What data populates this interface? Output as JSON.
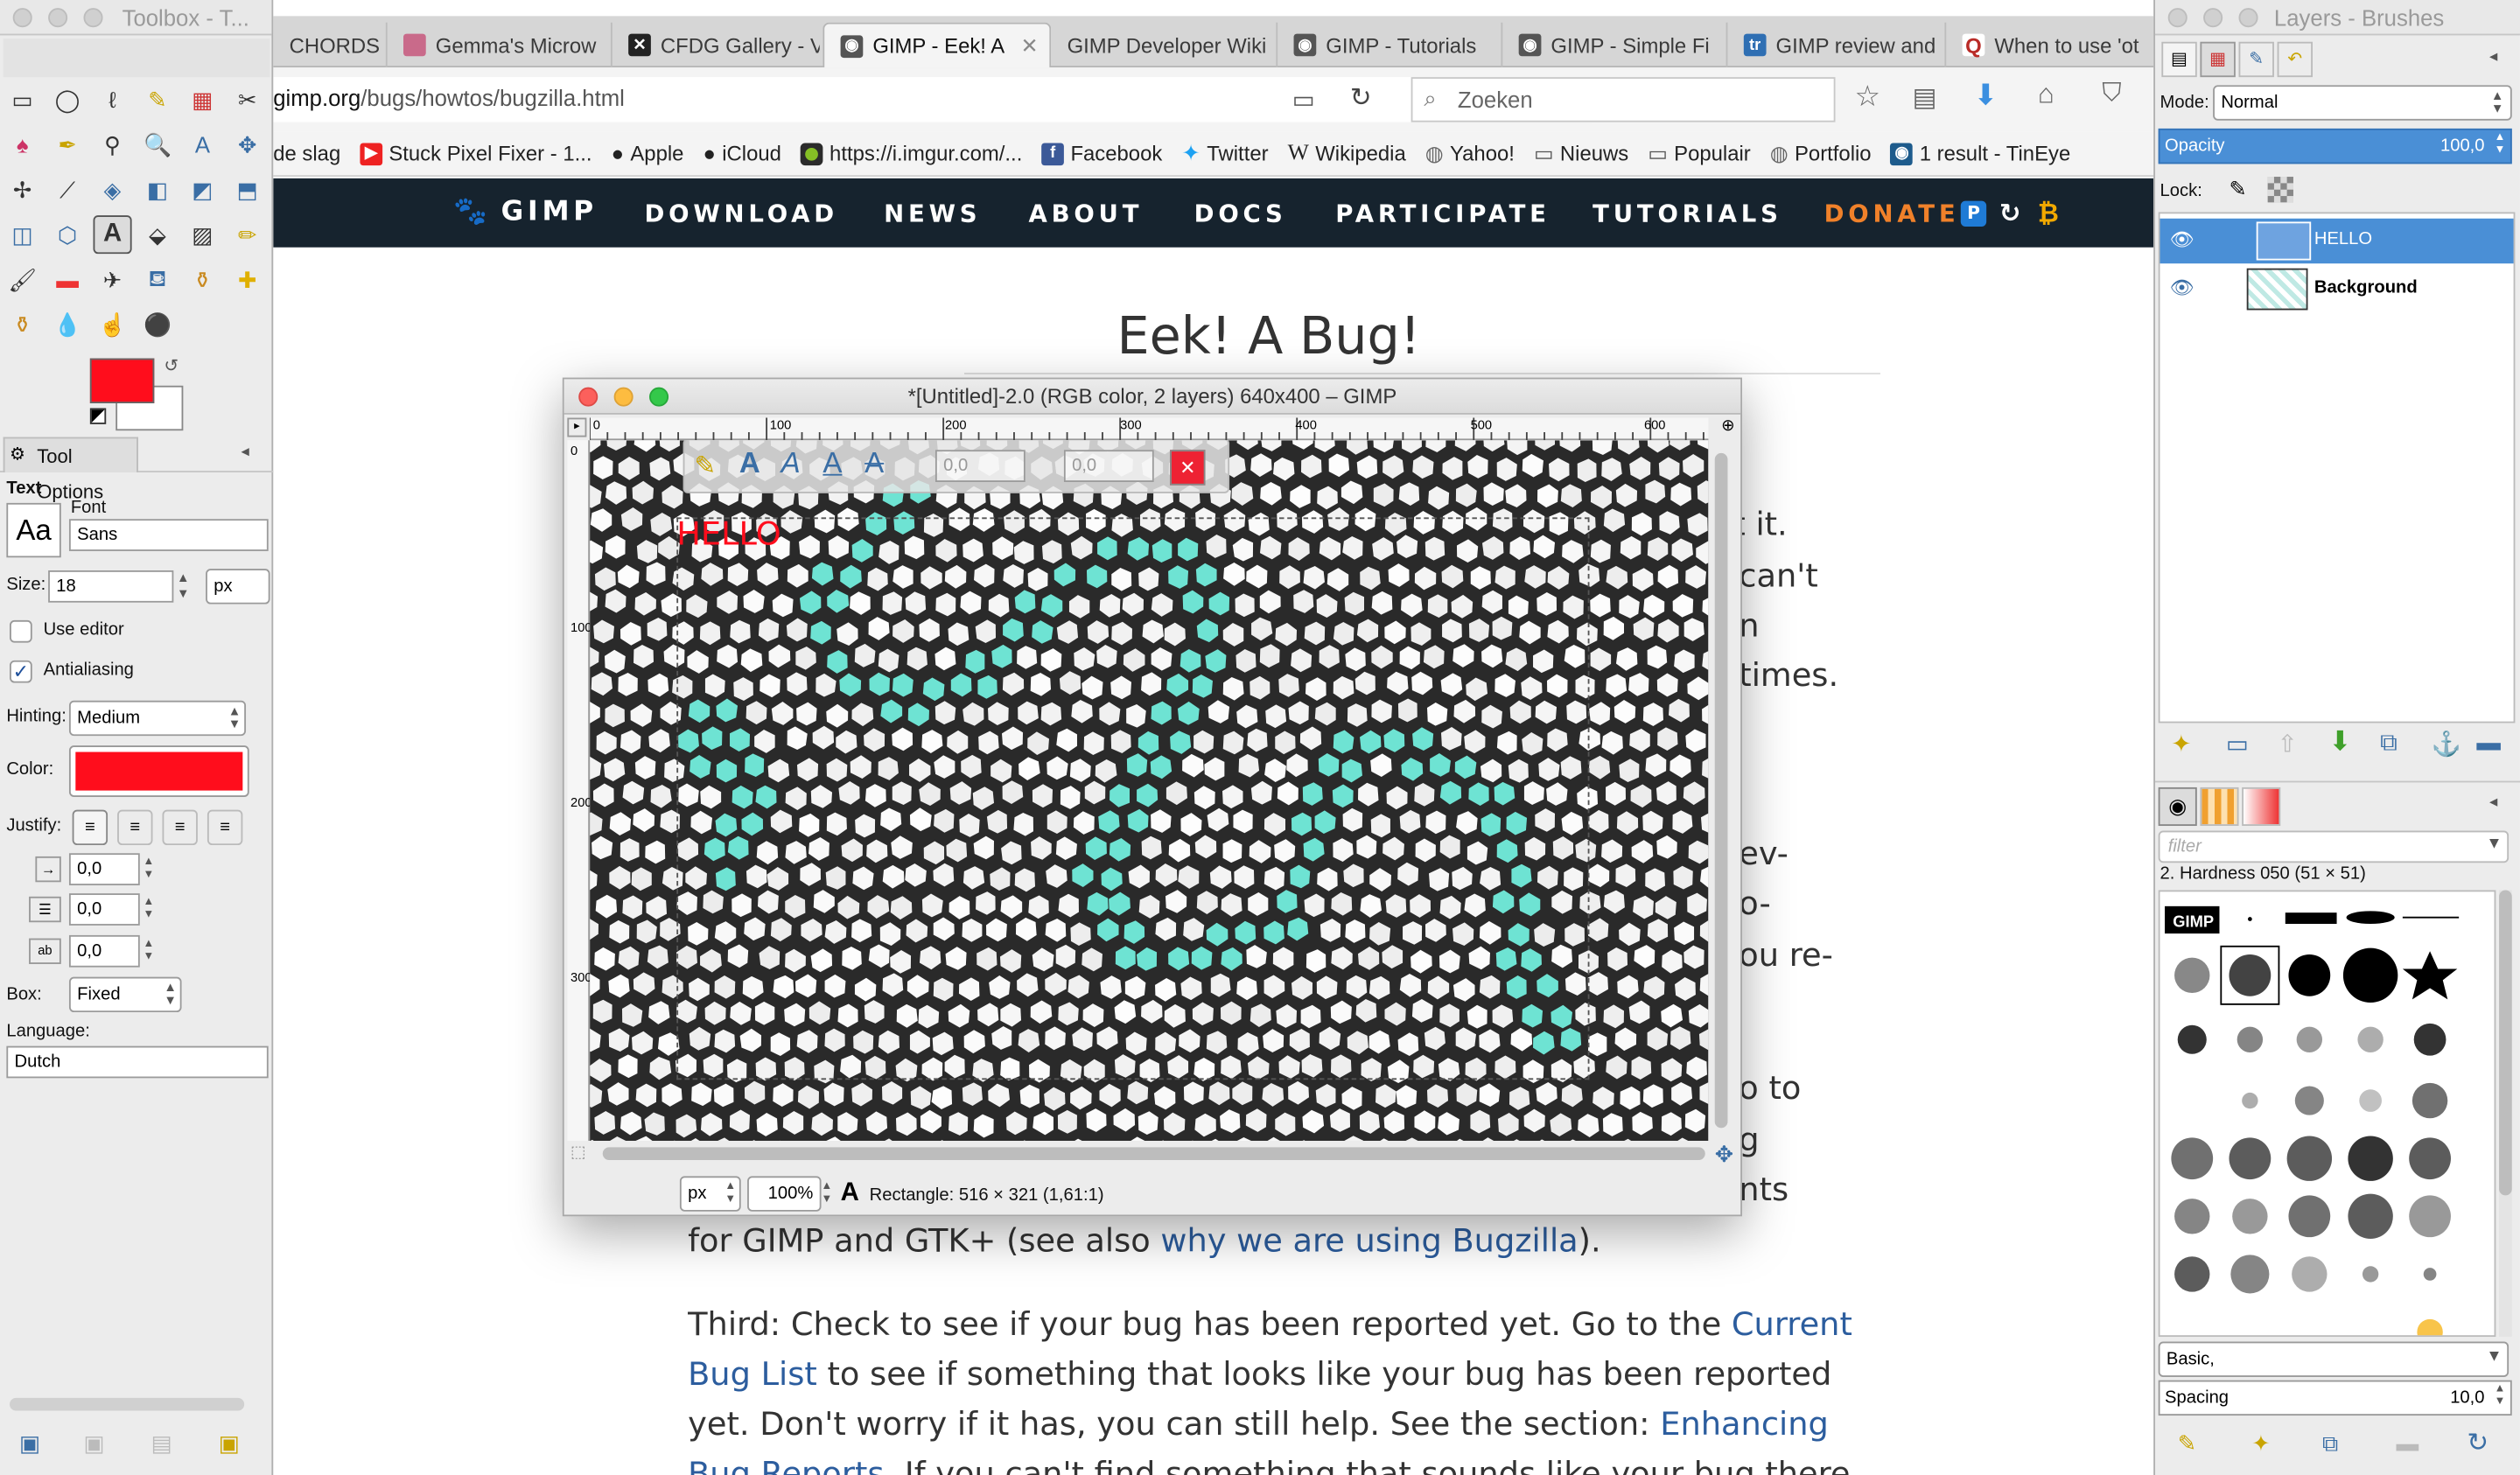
{
  "toolbox": {
    "title": "Toolbox - T...",
    "tool_options_tab": "Tool Options",
    "section": "Text",
    "font_label": "Font",
    "font_value": "Sans",
    "font_preview": "Aa",
    "size_label": "Size:",
    "size_value": "18",
    "size_unit": "px",
    "use_editor": "Use editor",
    "antialiasing": "Antialiasing",
    "hinting_label": "Hinting:",
    "hinting_value": "Medium",
    "color_label": "Color:",
    "justify_label": "Justify:",
    "indent_value": "0,0",
    "line_spacing_value": "0,0",
    "letter_spacing_value": "0,0",
    "box_label": "Box:",
    "box_value": "Fixed",
    "language_label": "Language:",
    "language_value": "Dutch",
    "fg_color": "#ff0d1c",
    "text_color": "#ff0d1c"
  },
  "browser": {
    "tabs": [
      {
        "label": "CHORDS"
      },
      {
        "label": "Gemma's Microw"
      },
      {
        "label": "CFDG Gallery - V"
      },
      {
        "label": "GIMP - Eek! A",
        "active": true
      },
      {
        "label": "GIMP Developer Wiki"
      },
      {
        "label": "GIMP - Tutorials"
      },
      {
        "label": "GIMP - Simple Fi"
      },
      {
        "label": "GIMP review and"
      },
      {
        "label": "When to use 'ot"
      }
    ],
    "url_domain": "gimp.org",
    "url_path": "/bugs/howtos/bugzilla.html",
    "search_placeholder": "Zoeken",
    "bookmarks": [
      "de slag",
      "Stuck Pixel Fixer - 1...",
      "Apple",
      "iCloud",
      "https://i.imgur.com/...",
      "Facebook",
      "Twitter",
      "Wikipedia",
      "Yahoo!",
      "Nieuws",
      "Populair",
      "Portfolio",
      "1 result - TinEye"
    ]
  },
  "site": {
    "logo": "GIMP",
    "nav": [
      "DOWNLOAD",
      "NEWS",
      "ABOUT",
      "DOCS",
      "PARTICIPATE",
      "TUTORIALS"
    ],
    "donate": "DONATE",
    "heading": "Eek! A Bug!",
    "frag": [
      "rt it.",
      "can't",
      "n",
      "times.",
      "ev-",
      "o-",
      "ou re-",
      "o to",
      "g",
      "nts"
    ],
    "para_line1_a": "for GIMP and GTK+ (see also ",
    "para_line1_link": "why we are using Bugzilla",
    "para_line1_b": ").",
    "p2_1a": "Third: Check to see if your bug has been reported yet. Go to the ",
    "p2_1link": "Current",
    "p2_2link": "Bug List",
    "p2_2b": " to see if something that looks like your bug has been reported",
    "p2_3a": "yet. Don't worry if it has, you can still help. See the section: ",
    "p2_3link": "Enhancing",
    "p2_4link": "Bug Reports",
    "p2_4b": ". If you can't find something that sounds like your bug there"
  },
  "image_window": {
    "title": "*[Untitled]-2.0 (RGB color, 2 layers) 640x400 – GIMP",
    "ruler": [
      "0",
      "100",
      "200",
      "300",
      "400",
      "500",
      "600"
    ],
    "vruler": [
      "0",
      "100",
      "200",
      "300"
    ],
    "unit": "px",
    "zoom": "100%",
    "status": "Rectangle: 516 × 321  (1,61:1)",
    "text_on_canvas": "HELLO",
    "overlay_val1": "0,0",
    "overlay_val2": "0,0",
    "mosaic_color": "#6ee3d3"
  },
  "layers": {
    "title": "Layers - Brushes",
    "mode_label": "Mode:",
    "mode_value": "Normal",
    "opacity_label": "Opacity",
    "opacity_value": "100,0",
    "lock_label": "Lock:",
    "items": [
      {
        "name": "HELLO",
        "selected": true
      },
      {
        "name": "Background",
        "selected": false
      }
    ]
  },
  "brushes": {
    "filter_placeholder": "filter",
    "current": "2. Hardness 050 (51 × 51)",
    "tag_value": "Basic,",
    "spacing_label": "Spacing",
    "spacing_value": "10,0",
    "brush_logo": "GIMP"
  }
}
